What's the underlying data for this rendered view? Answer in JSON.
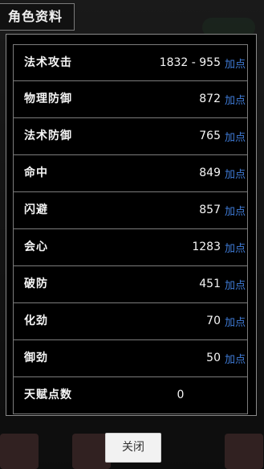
{
  "title": "角色资料",
  "attributes": [
    {
      "label": "法术攻击",
      "value": "1832 - 955",
      "add_label": "加点"
    },
    {
      "label": "物理防御",
      "value": "872",
      "add_label": "加点"
    },
    {
      "label": "法术防御",
      "value": "765",
      "add_label": "加点"
    },
    {
      "label": "命中",
      "value": "849",
      "add_label": "加点"
    },
    {
      "label": "闪避",
      "value": "857",
      "add_label": "加点"
    },
    {
      "label": "会心",
      "value": "1283",
      "add_label": "加点"
    },
    {
      "label": "破防",
      "value": "451",
      "add_label": "加点"
    },
    {
      "label": "化劲",
      "value": "70",
      "add_label": "加点"
    },
    {
      "label": "御劲",
      "value": "50",
      "add_label": "加点"
    },
    {
      "label": "天赋点数",
      "value": "0"
    }
  ],
  "close_label": "关闭",
  "colors": {
    "add_link": "#3f7cd8",
    "panel_bg": "#000000",
    "border": "#7c7c7c"
  }
}
